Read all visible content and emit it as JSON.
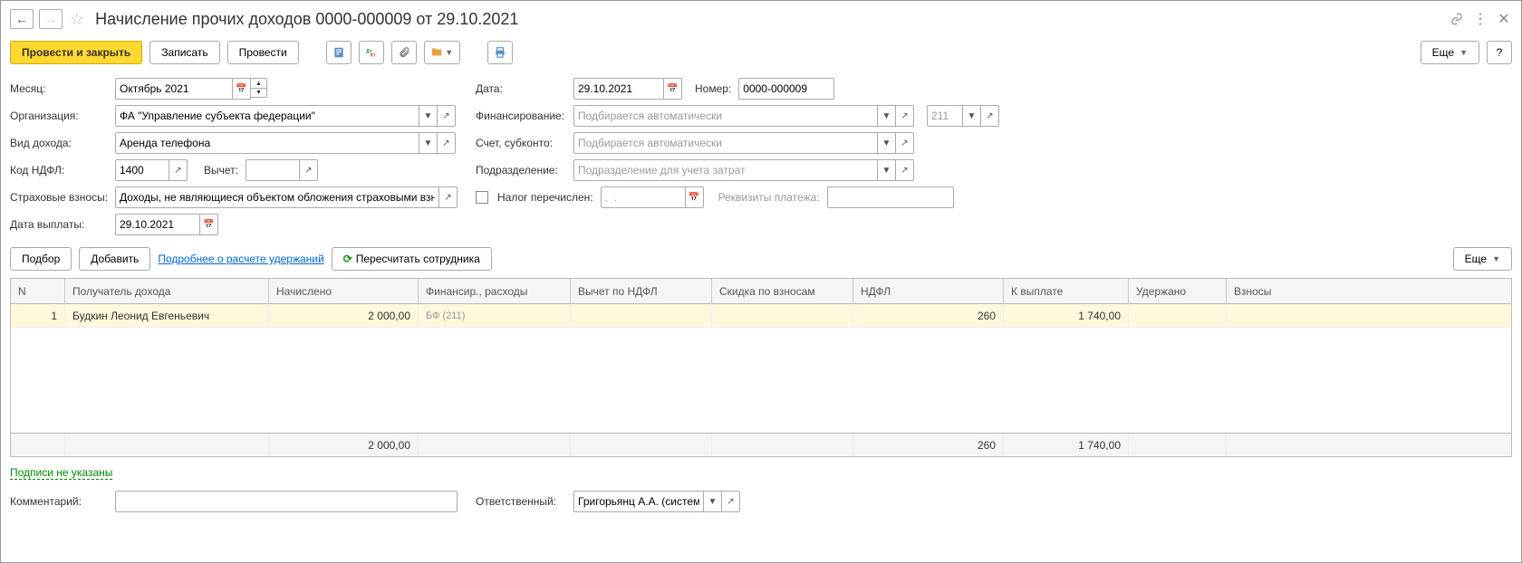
{
  "titlebar": {
    "title": "Начисление прочих доходов 0000-000009 от 29.10.2021"
  },
  "toolbar": {
    "post_close": "Провести и закрыть",
    "save": "Записать",
    "post": "Провести",
    "more": "Еще",
    "help": "?"
  },
  "form": {
    "month_label": "Месяц:",
    "month_value": "Октябрь 2021",
    "date_label": "Дата:",
    "date_value": "29.10.2021",
    "number_label": "Номер:",
    "number_value": "0000-000009",
    "org_label": "Организация:",
    "org_value": "ФА \"Управление субъекта федерации\"",
    "fin_label": "Финансирование:",
    "fin_placeholder": "Подбирается автоматически",
    "extra_code": "211",
    "income_type_label": "Вид дохода:",
    "income_type_value": "Аренда телефона",
    "account_label": "Счет, субконто:",
    "account_placeholder": "Подбирается автоматически",
    "ndfl_code_label": "Код НДФЛ:",
    "ndfl_code_value": "1400",
    "deduct_label": "Вычет:",
    "deduct_value": "",
    "division_label": "Подразделение:",
    "division_placeholder": "Подразделение для учета затрат",
    "ins_label": "Страховые взносы:",
    "ins_value": "Доходы, не являющиеся объектом обложения страховыми взносами",
    "tax_transferred_label": "Налог перечислен:",
    "tax_date_placeholder": ".  .",
    "payment_details_label": "Реквизиты платежа:",
    "pay_date_label": "Дата выплаты:",
    "pay_date_value": "29.10.2021"
  },
  "table_toolbar": {
    "select": "Подбор",
    "add": "Добавить",
    "details_link": "Подробнее о расчете удержаний",
    "recalc": "Пересчитать сотрудника",
    "more": "Еще"
  },
  "table": {
    "headers": {
      "n": "N",
      "recipient": "Получатель дохода",
      "accrued": "Начислено",
      "finance": "Финансир., расходы",
      "ndfl_deduct": "Вычет по НДФЛ",
      "ins_discount": "Скидка по взносам",
      "ndfl": "НДФЛ",
      "to_pay": "К выплате",
      "withheld": "Удержано",
      "contributions": "Взносы"
    },
    "rows": [
      {
        "n": "1",
        "recipient": "Будкин Леонид Евгеньевич",
        "accrued": "2 000,00",
        "finance": "БФ  (211)",
        "ndfl_deduct": "",
        "ins_discount": "",
        "ndfl": "260",
        "to_pay": "1 740,00",
        "withheld": "",
        "contributions": ""
      }
    ],
    "footer": {
      "accrued": "2 000,00",
      "ndfl": "260",
      "to_pay": "1 740,00"
    }
  },
  "bottom": {
    "sign_link": "Подписи не указаны",
    "comment_label": "Комментарий:",
    "comment_value": "",
    "responsible_label": "Ответственный:",
    "responsible_value": "Григорьянц А.А. (системный программист)"
  }
}
